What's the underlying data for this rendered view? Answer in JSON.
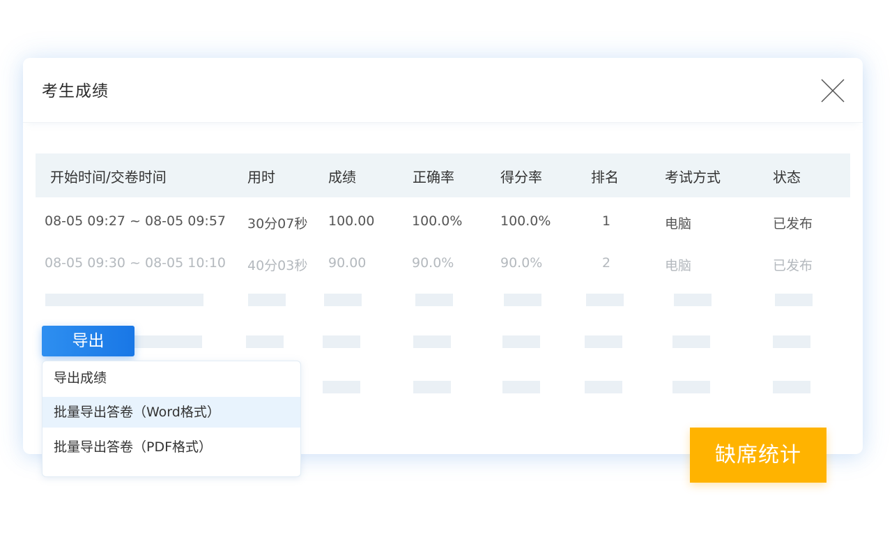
{
  "modal": {
    "title": "考生成绩"
  },
  "table": {
    "headers": [
      "开始时间/交卷时间",
      "用时",
      "成绩",
      "正确率",
      "得分率",
      "排名",
      "考试方式",
      "状态"
    ],
    "rows": [
      [
        "08-05 09:27 ~ 08-05 09:57",
        "30分07秒",
        "100.00",
        "100.0%",
        "100.0%",
        "1",
        "电脑",
        "已发布"
      ],
      [
        "08-05 09:30 ~ 08-05 10:10",
        "40分03秒",
        "90.00",
        "90.0%",
        "90.0%",
        "2",
        "电脑",
        "已发布"
      ]
    ]
  },
  "export": {
    "label": "导出",
    "menu": [
      "导出成绩",
      "批量导出答卷（Word格式）",
      "批量导出答卷（PDF格式）"
    ],
    "hovered_index": 1
  },
  "absent_button": {
    "label": "缺席统计"
  },
  "colors": {
    "primary": "#1977e6",
    "accent": "#ffb300",
    "header_bg": "#eef4f7",
    "skeleton": "#eaf0f5"
  },
  "icons": {
    "close": "close-icon"
  }
}
